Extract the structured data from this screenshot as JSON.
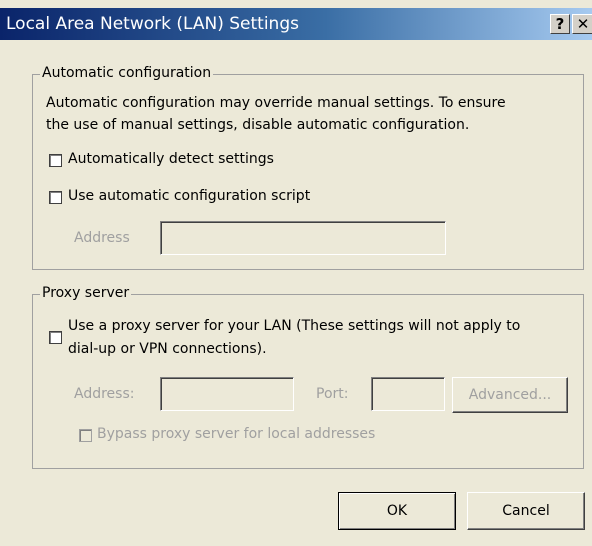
{
  "window": {
    "title": "Local Area Network (LAN) Settings",
    "help_label": "?",
    "close_label": "✕"
  },
  "auto_config": {
    "group_label": "Automatic configuration",
    "description_line1": "Automatic configuration may override manual settings.  To ensure",
    "description_line2": "the use of manual settings, disable automatic configuration.",
    "detect_label": "Automatically detect settings",
    "detect_checked": false,
    "script_label": "Use automatic configuration script",
    "script_checked": false,
    "address_label": "Address",
    "address_value": ""
  },
  "proxy": {
    "group_label": "Proxy server",
    "use_proxy_line1": "Use a proxy server for your LAN (These settings will not apply to",
    "use_proxy_line2": "dial-up or VPN connections).",
    "use_proxy_checked": false,
    "address_label": "Address:",
    "address_value": "",
    "port_label": "Port:",
    "port_value": "",
    "advanced_label": "Advanced...",
    "bypass_label": "Bypass proxy server for local addresses",
    "bypass_checked": false
  },
  "buttons": {
    "ok_label": "OK",
    "cancel_label": "Cancel"
  }
}
